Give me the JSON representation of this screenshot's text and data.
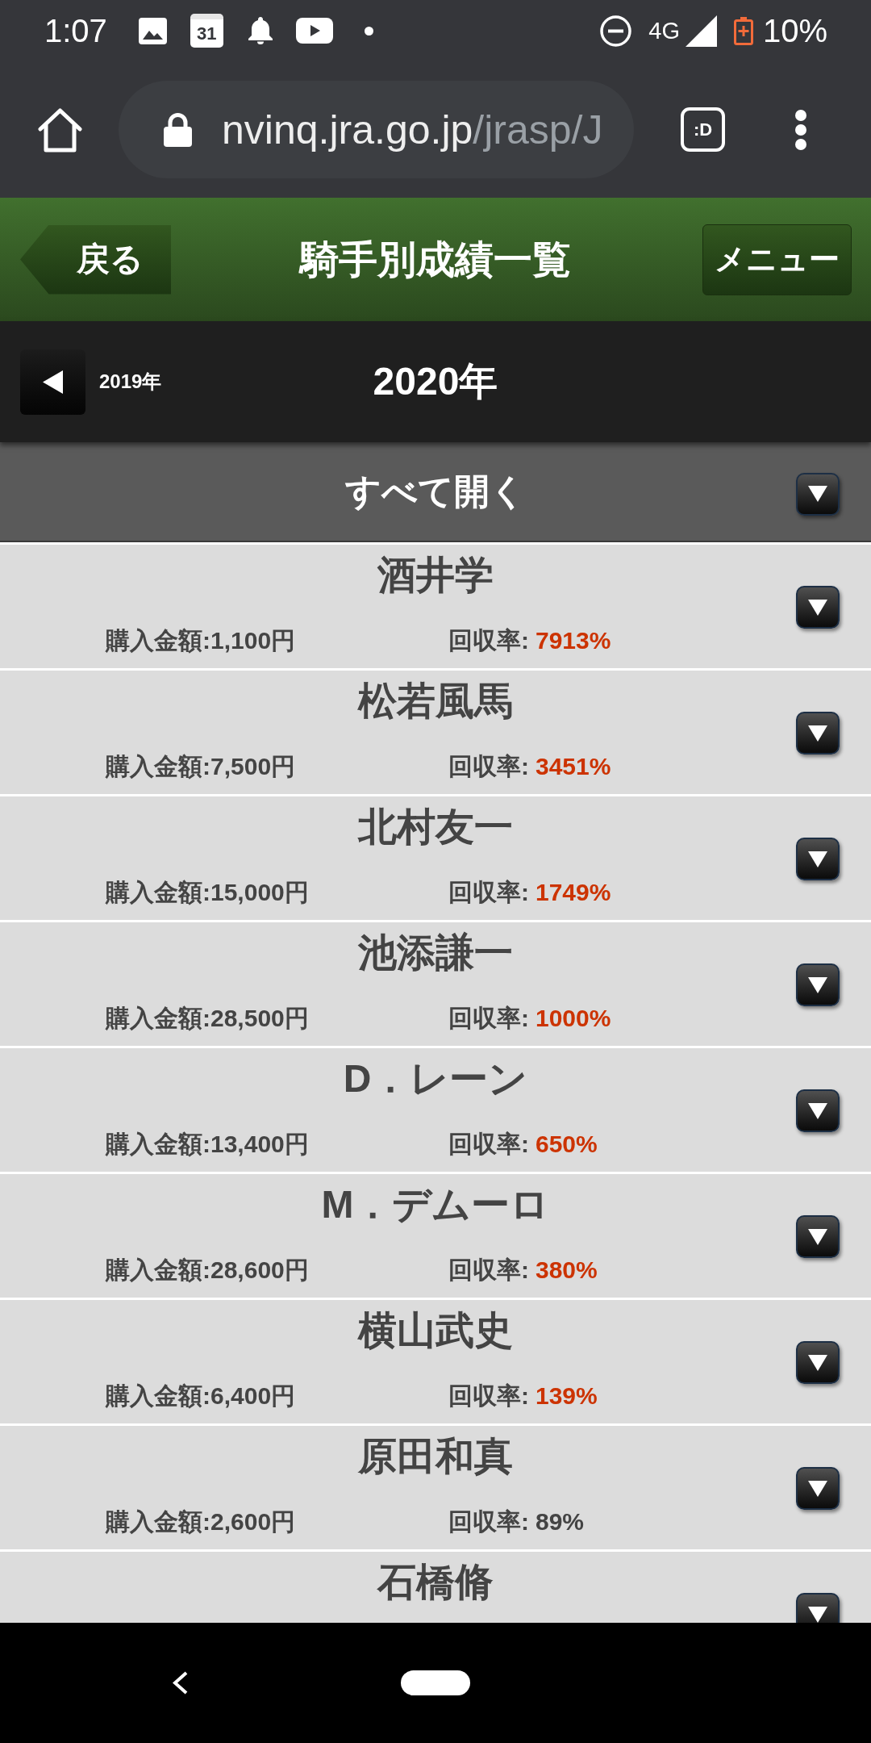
{
  "status_bar": {
    "time": "1:07",
    "calendar_day": "31",
    "network": "4G",
    "battery": "10%"
  },
  "browser": {
    "url_host": "nvinq.jra.go.jp",
    "url_path": "/jrasp/J",
    "tab_count": ":D"
  },
  "header": {
    "back_button": "戻る",
    "title": "騎手別成績一覧",
    "menu_button": "メニュー"
  },
  "year_nav": {
    "previous": "2019年",
    "current": "2020年"
  },
  "expand_all": {
    "label": "すべて開く"
  },
  "jockeys": [
    {
      "name": "酒井学",
      "purchase": "購入金額:1,100円",
      "rate_label": "回収率:",
      "rate": "7913%",
      "highlighted": true,
      "expanded": false
    },
    {
      "name": "松若風馬",
      "purchase": "購入金額:7,500円",
      "rate_label": "回収率:",
      "rate": "3451%",
      "highlighted": true,
      "expanded": false
    },
    {
      "name": "北村友一",
      "purchase": "購入金額:15,000円",
      "rate_label": "回収率:",
      "rate": "1749%",
      "highlighted": true,
      "expanded": false
    },
    {
      "name": "池添謙一",
      "purchase": "購入金額:28,500円",
      "rate_label": "回収率:",
      "rate": "1000%",
      "highlighted": true,
      "expanded": false
    },
    {
      "name": "D．レーン",
      "purchase": "購入金額:13,400円",
      "rate_label": "回収率:",
      "rate": "650%",
      "highlighted": true,
      "expanded": false
    },
    {
      "name": "M．デムーロ",
      "purchase": "購入金額:28,600円",
      "rate_label": "回収率:",
      "rate": "380%",
      "highlighted": true,
      "expanded": false
    },
    {
      "name": "横山武史",
      "purchase": "購入金額:6,400円",
      "rate_label": "回収率:",
      "rate": "139%",
      "highlighted": true,
      "expanded": false
    },
    {
      "name": "原田和真",
      "purchase": "購入金額:2,600円",
      "rate_label": "回収率:",
      "rate": "89%",
      "highlighted": false,
      "expanded": false
    },
    {
      "name": "石橋脩",
      "expanded": false
    }
  ]
}
